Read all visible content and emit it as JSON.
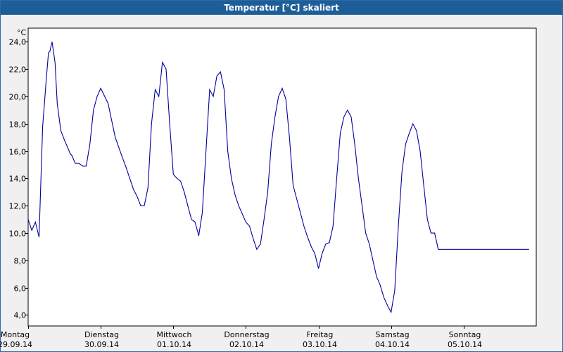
{
  "window": {
    "title": "Temperatur [°C] skaliert"
  },
  "colors": {
    "line": "#0000a0",
    "grid": "#000000",
    "title_bg": "#1d5e99",
    "background": "#f0f0f0"
  },
  "chart_data": {
    "type": "line",
    "title": "Temperatur [°C] skaliert",
    "ylabel": "°C",
    "xlabel": "",
    "ylim": [
      3.2,
      25.0
    ],
    "xlim": [
      0,
      7
    ],
    "grid": true,
    "y_ticks": [
      4.0,
      6.0,
      8.0,
      10.0,
      12.0,
      14.0,
      16.0,
      18.0,
      20.0,
      22.0,
      24.0
    ],
    "y_tick_labels": [
      "4,0",
      "6,0",
      "8,0",
      "10,0",
      "12,0",
      "14,0",
      "16,0",
      "18,0",
      "20,0",
      "22,0",
      "24,0"
    ],
    "x_ticks": [
      {
        "x": 0,
        "day": "Montag",
        "date": "29.09.14"
      },
      {
        "x": 1,
        "day": "Dienstag",
        "date": "30.09.14"
      },
      {
        "x": 2,
        "day": "Mittwoch",
        "date": "01.10.14"
      },
      {
        "x": 3,
        "day": "Donnerstag",
        "date": "02.10.14"
      },
      {
        "x": 4,
        "day": "Freitag",
        "date": "03.10.14"
      },
      {
        "x": 5,
        "day": "Samstag",
        "date": "04.10.14"
      },
      {
        "x": 6,
        "day": "Sonntag",
        "date": "05.10.14"
      }
    ],
    "series": [
      {
        "x": [
          0.0,
          0.05,
          0.1,
          0.15,
          0.2,
          0.25,
          0.28,
          0.3,
          0.33,
          0.37,
          0.4,
          0.45,
          0.5,
          0.55,
          0.58,
          0.6,
          0.65,
          0.7,
          0.75,
          0.8,
          0.85,
          0.9,
          0.95,
          1.0,
          1.1,
          1.2,
          1.3,
          1.35,
          1.4,
          1.45,
          1.5,
          1.55,
          1.6,
          1.65,
          1.7,
          1.75,
          1.8,
          1.85,
          1.9,
          1.95,
          2.0,
          2.05,
          2.1,
          2.15,
          2.2,
          2.25,
          2.3,
          2.35,
          2.4,
          2.45,
          2.5,
          2.55,
          2.6,
          2.65,
          2.7,
          2.75,
          2.8,
          2.85,
          2.9,
          2.95,
          3.0,
          3.05,
          3.1,
          3.15,
          3.2,
          3.25,
          3.3,
          3.35,
          3.4,
          3.45,
          3.5,
          3.55,
          3.6,
          3.65,
          3.7,
          3.75,
          3.8,
          3.85,
          3.9,
          3.95,
          4.0,
          4.05,
          4.1,
          4.15,
          4.2,
          4.25,
          4.3,
          4.35,
          4.4,
          4.45,
          4.5,
          4.55,
          4.6,
          4.65,
          4.7,
          4.75,
          4.8,
          4.85,
          4.9,
          4.95,
          5.0,
          5.05,
          5.1,
          5.15,
          5.2,
          5.25,
          5.3,
          5.35,
          5.4,
          5.45,
          5.5,
          5.55,
          5.6,
          5.65,
          5.7,
          5.75,
          5.8,
          5.85,
          5.9,
          5.95,
          6.0,
          6.05,
          6.1,
          6.15,
          6.2,
          6.25,
          6.3,
          6.35,
          6.4,
          6.45,
          6.5,
          6.55,
          6.6,
          6.65,
          6.7,
          6.75,
          6.8,
          6.85,
          6.9
        ],
        "y": [
          11.0,
          10.2,
          10.8,
          9.7,
          17.8,
          21.3,
          23.2,
          23.3,
          24.0,
          22.5,
          19.5,
          17.5,
          16.8,
          16.2,
          15.8,
          15.7,
          15.1,
          15.1,
          14.9,
          14.9,
          16.5,
          19.0,
          20.0,
          20.6,
          19.5,
          17.0,
          15.5,
          14.8,
          14.0,
          13.2,
          12.7,
          12.0,
          12.0,
          13.3,
          18.0,
          20.5,
          20.0,
          22.5,
          22.0,
          18.0,
          14.3,
          14.0,
          13.8,
          13.0,
          12.0,
          11.0,
          10.8,
          9.8,
          11.5,
          16.0,
          20.5,
          20.0,
          21.5,
          21.8,
          20.5,
          16.0,
          14.0,
          12.8,
          12.0,
          11.4,
          10.8,
          10.5,
          9.6,
          8.8,
          9.2,
          11.0,
          13.0,
          16.5,
          18.5,
          20.0,
          20.6,
          19.8,
          17.0,
          13.5,
          12.5,
          11.5,
          10.5,
          9.7,
          9.0,
          8.5,
          7.4,
          8.5,
          9.2,
          9.3,
          10.5,
          14.0,
          17.3,
          18.5,
          19.0,
          18.5,
          16.5,
          14.0,
          12.0,
          10.0,
          9.2,
          8.0,
          6.8,
          6.2,
          5.3,
          4.7,
          4.2,
          5.8,
          10.5,
          14.5,
          16.5,
          17.3,
          18.0,
          17.5,
          16.0,
          13.5,
          11.0,
          10.0,
          10.0,
          8.8,
          8.8,
          8.8,
          8.8,
          8.8,
          8.8,
          8.8,
          8.8,
          8.8,
          8.8,
          8.8,
          8.8,
          8.8,
          8.8,
          8.8,
          8.8,
          8.8,
          8.8,
          8.8,
          8.8,
          8.8,
          8.8,
          8.8,
          8.8,
          8.8,
          8.8
        ]
      }
    ]
  }
}
